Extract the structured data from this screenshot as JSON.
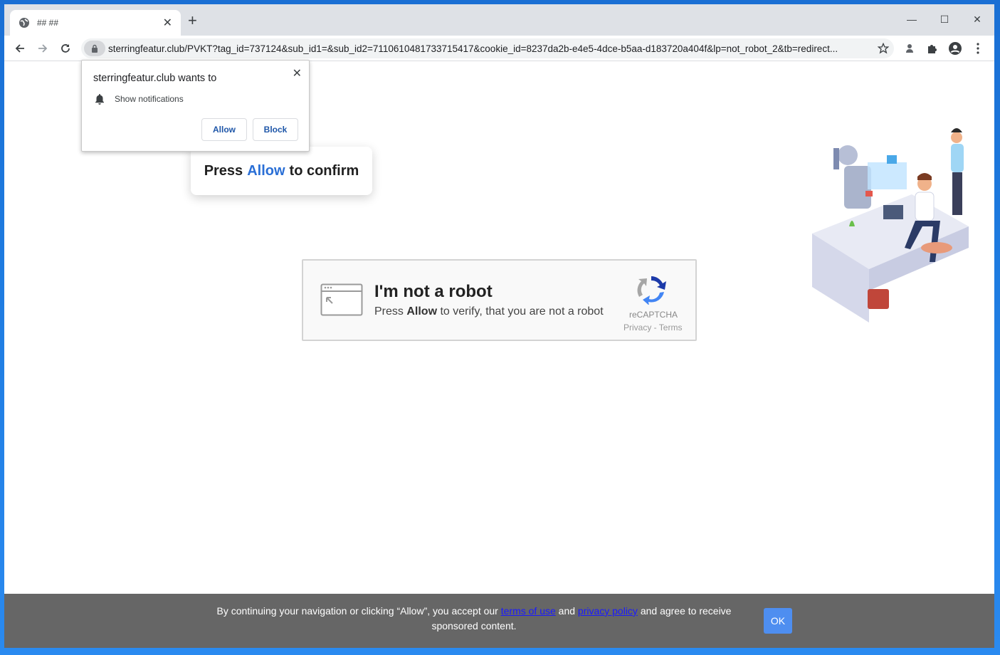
{
  "browser": {
    "tab_title": "## ##",
    "url": "sterringfeatur.club/PVKT?tag_id=737124&sub_id1=&sub_id2=7110610481733715417&cookie_id=8237da2b-e4e5-4dce-b5aa-d183720a404f&lp=not_robot_2&tb=redirect..."
  },
  "notification_popup": {
    "title": "sterringfeatur.club wants to",
    "permission": "Show notifications",
    "allow_label": "Allow",
    "block_label": "Block"
  },
  "press_box": {
    "prefix": "Press",
    "highlight": "Allow",
    "suffix": "to confirm"
  },
  "captcha": {
    "title": "I'm not a robot",
    "sub_prefix": "Press",
    "sub_bold": "Allow",
    "sub_suffix": "to verify, that you are not a robot",
    "brand": "reCAPTCHA",
    "links": "Privacy - Terms"
  },
  "cookie_bar": {
    "text_before": "By continuing your navigation or clicking “Allow”, you accept our",
    "terms_link": "terms of use",
    "and": "and",
    "privacy_link": "privacy policy",
    "text_after": "and agree to receive sponsored content.",
    "ok_label": "OK"
  },
  "colors": {
    "accent_blue": "#2a6fd6",
    "ok_button": "#4e8ef0",
    "cookie_bg": "#666666"
  }
}
